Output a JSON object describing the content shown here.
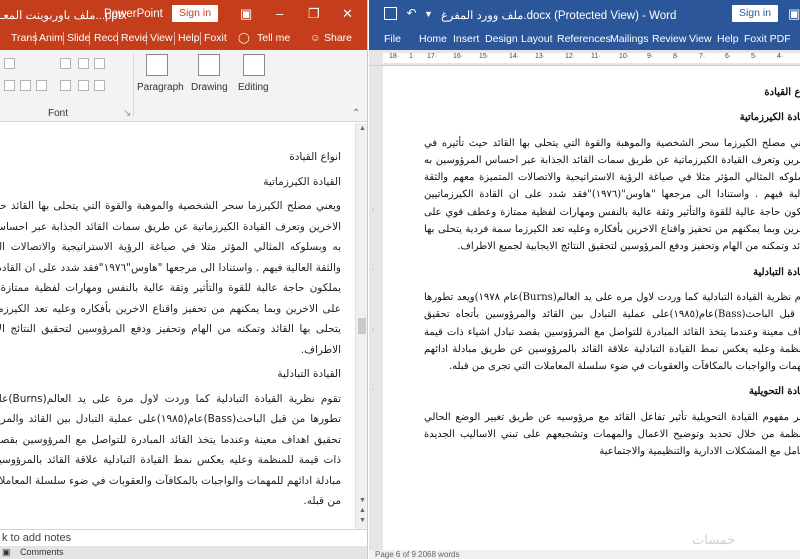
{
  "ppt": {
    "title": "ملف باوربوينت المعـ...pptx",
    "app_name": "PowerPoint",
    "sign_in": "Sign in",
    "tabs": [
      "Trans",
      "Anim",
      "Slide",
      "Reco",
      "Revie",
      "View",
      "Help",
      "Foxit"
    ],
    "tell_me": "Tell me",
    "share": "Share",
    "ribbon": {
      "font_group": "Font",
      "paragraph": "Paragraph",
      "drawing": "Drawing",
      "editing": "Editing"
    },
    "slide_text": {
      "h1": "انواع القيادة",
      "h2": "القيادة الكيرزماتية",
      "p1": "ويعني مصلح الكيرزما سحر الشخصية والموهبة والقوة التي يتحلى بها القائد حيث تأثيره في الاخرين وتعرف القيادة الكيرزماتية عن طريق سمات القائد الجذابة عبر احساس المرؤوسين به وبسلوكه المثالي المؤثر مثلا في صياغة الرؤية الاستراتيجية والاتصالات المتميزة معهم والثقة العالية فيهم . واستنادا الى مرجعها \"هاوس\"١٩٧٦\"فقد شدد على ان القادة الكيرزماتيين يملكون حاجة عالية للقوة والتأثير وثقة عالية بالنفس ومهارات لفظية ممتازة وعطف قوي على الاخرين وبما يمكنهم من تحفيز واقناع الاخرين بأفكاره وعليه تعد الكيرزما سمة فردية يتحلى بها القائد وتمكنه من الهام وتحفيز ودفع المرؤوسين لتحقيق النتائج الايجابية لجميع الاطراف.",
      "h3": "القيادة التبادلية",
      "p2": "تقوم نظرية القيادة التبادلية كما وردت لاول مرة على يد العالم(Burns)عام ١٩٧٨)ويعد تطورها من قبل الباحث(Bass)عام(١٩٨٥)على عملية التبادل بين القائد والمرؤوسين بأتجاه تحقيق اهداف معينة وعندما يتخذ القائد المبادرة للتواصل مع المرؤوسين بقصد تبادل اشياء ذات قيمة للمنظمة وعليه يعكس نمط القيادة التبادلية علاقة القائد بالمرؤوسين عن طريق مبادلة ادائهم للمهمات والواجبات بالمكافآت والعقوبات في ضوء سلسلة المعاملات التي تجري من قبله."
    },
    "notes": "k to add notes",
    "status": "Comments"
  },
  "word": {
    "title": "ملف وورد المفرغ.docx (Protected View)  -  Word",
    "sign_in": "Sign in",
    "tabs": [
      "File",
      "Home",
      "Insert",
      "Design",
      "Layout",
      "References",
      "Mailings",
      "Review",
      "View",
      "Help",
      "Foxit PDF"
    ],
    "doc": {
      "h1": "انواع القيادة",
      "h2": "القيادة الكيرزماتية",
      "p1": "ويعني مصلح الكيرزما سحر الشخصية والموهبة والقوة التي يتحلى بها القائد حيث تأثيره في الاخرين وتعرف القيادة الكيرزماتية عن طريق سمات القائد الجذابة عبر احساس المرؤوسين به وبسلوكه المثالي المؤثر مثلا في صياغة الرؤية الاستراتيجية والاتصالات المتميزة معهم والثقة العالية فيهم . واستنادا الى مرجعها \"هاوس\"(١٩٧٦)\"فقد شدد على ان القادة الكيرزماتيين يملكون حاجة عالية للقوة والتأثير وثقة عالية بالنفس ومهارات لفظية ممتازة وعطف قوي على الاخرين وبما يمكنهم من تحفيز واقناع الاخرين بأفكاره وعليه تعد الكيرزما سمة فردية يتحلى بها القائد وتمكنه من الهام وتحفيز ودفع المرؤوسين لتحقيق النتائج الايجابية لجميع الاطراف.",
      "h3": "القيادة التبادلية",
      "p2": "تقوم نظرية القيادة التبادلية كما وردت لاول مره على يد العالم(Burns)عام ١٩٧٨)ويعد تطورها من قبل الباحث(Bass)عام(١٩٨٥)على عملية التبادل بين القائد والمرؤوسين بأتجاه تحقيق اهداف معينة وعندما يتخذ القائد المبادرة للتواصل مع المرؤوسين بقصد تبادل اشياء ذات قيمة للمنظمة وعليه يعكس نمط القيادة التبادلية علاقة القائد بالمرؤوسين عن طريق مبادلة ادائهم للمهمات والواجبات بالمكافآت والعقوبات في ضوء سلسلة المعاملات التي تجرى من قبله.",
      "h4": "القيادة التحويلية",
      "p3": "يشير مفهوم القيادة التحويلية تأثير تفاعل القائد مع مرؤوسيه عن طريق تغيير الوضع الحالي للمنظمة من خلال تحديد وتوضيح الاعمال والمهمات وتشجيعهم على تبني الاساليب الجديدة للتعامل مع المشكلات الادارية والتنظيمية والاجتماعية"
    },
    "status": "Page 6 of 9     2068 words"
  },
  "watermark": "خمسات"
}
